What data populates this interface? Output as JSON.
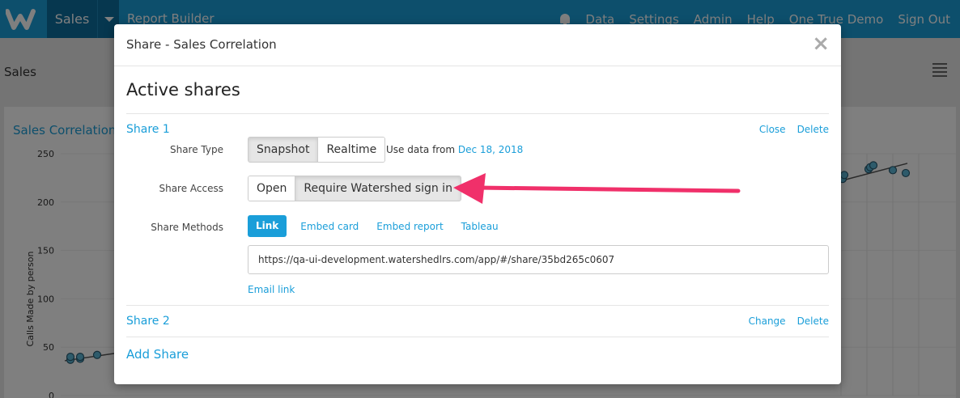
{
  "topbar": {
    "logo_icon": "w-logo-icon",
    "sales_label": "Sales",
    "report_builder_label": "Report Builder",
    "nav_items": [
      "Data",
      "Settings",
      "Admin",
      "Help",
      "One True Demo",
      "Sign Out"
    ]
  },
  "page": {
    "title": "Sales",
    "card_title": "Sales Correlation"
  },
  "chart_data": {
    "type": "scatter",
    "ylabel": "Calls Made by person",
    "ylim": [
      0,
      250
    ],
    "yticks": [
      0,
      50,
      100,
      150,
      200,
      250
    ],
    "visible_points_left": [
      [
        0,
        37
      ],
      [
        0,
        40
      ],
      [
        1,
        38
      ],
      [
        1,
        40
      ],
      [
        2,
        42
      ]
    ],
    "visible_points_right": [
      [
        0,
        224
      ],
      [
        1,
        228
      ],
      [
        2,
        234
      ],
      [
        3,
        236
      ],
      [
        3,
        238
      ],
      [
        4,
        233
      ],
      [
        5,
        230
      ]
    ]
  },
  "modal": {
    "title": "Share - Sales Correlation",
    "close_glyph": "×",
    "heading": "Active shares",
    "share1": {
      "name": "Share 1",
      "close_label": "Close",
      "delete_label": "Delete",
      "type_label": "Share Type",
      "type_options": [
        "Snapshot",
        "Realtime"
      ],
      "type_selected": "Snapshot",
      "use_data_prefix": "Use data from",
      "use_data_date": "Dec 18, 2018",
      "access_label": "Share Access",
      "access_options": [
        "Open",
        "Require Watershed sign in"
      ],
      "access_selected": "Require Watershed sign in",
      "methods_label": "Share Methods",
      "methods": [
        "Link",
        "Embed card",
        "Embed report",
        "Tableau"
      ],
      "method_selected": "Link",
      "url": "https://qa-ui-development.watershedlrs.com/app/#/share/35bd265c0607",
      "email_link": "Email link"
    },
    "share2": {
      "name": "Share 2",
      "change_label": "Change",
      "delete_label": "Delete"
    },
    "add_share_label": "Add Share"
  },
  "annotation": {
    "arrow_color": "#f0306a"
  }
}
